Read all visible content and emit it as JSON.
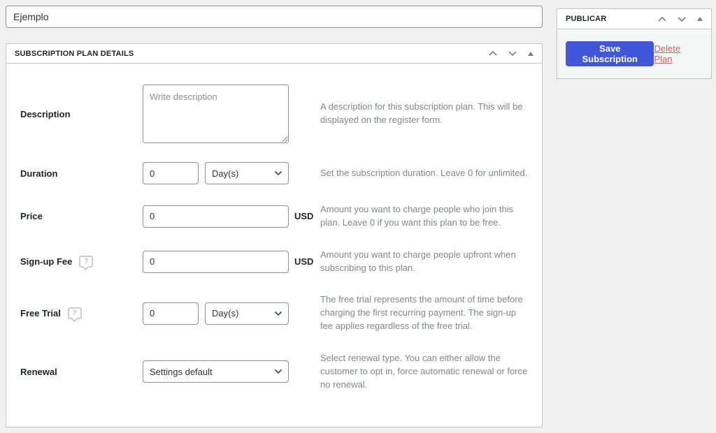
{
  "page_title_input": {
    "value": "Ejemplo"
  },
  "details_box": {
    "title": "SUBSCRIPTION PLAN DETAILS",
    "rows": [
      {
        "label": "Description",
        "placeholder": "Write description",
        "help": "A description for this subscription plan. This will be displayed on the register form."
      },
      {
        "label": "Duration",
        "value": "0",
        "select_value": "Day(s)",
        "help": "Set the subscription duration. Leave 0 for unlimited."
      },
      {
        "label": "Price",
        "value": "0",
        "suffix": "USD",
        "help": "Amount you want to charge people who join this plan. Leave 0 if you want this plan to be free."
      },
      {
        "label": "Sign-up Fee",
        "value": "0",
        "suffix": "USD",
        "help": "Amount you want to charge people upfront when subscribing to this plan."
      },
      {
        "label": "Free Trial",
        "value": "0",
        "select_value": "Day(s)",
        "help": "The free trial represents the amount of time before charging the first recurring payment. The sign-up fee applies regardless of the free trial."
      },
      {
        "label": "Renewal",
        "select_value": "Settings default",
        "help": "Select renewal type. You can either allow the customer to opt in, force automatic renewal or force no renewal."
      }
    ]
  },
  "publish_box": {
    "title": "PUBLICAR",
    "save_button": "Save Subscription",
    "delete_link": "Delete Plan"
  },
  "icons": {
    "help_glyph": "?"
  },
  "colors": {
    "accent": "#4256da",
    "delete_link": "#cd6557",
    "page_bg": "#f0f0f1",
    "box_border": "#c3c4c7",
    "input_border": "#8c8f94",
    "help_text": "#82878c"
  }
}
